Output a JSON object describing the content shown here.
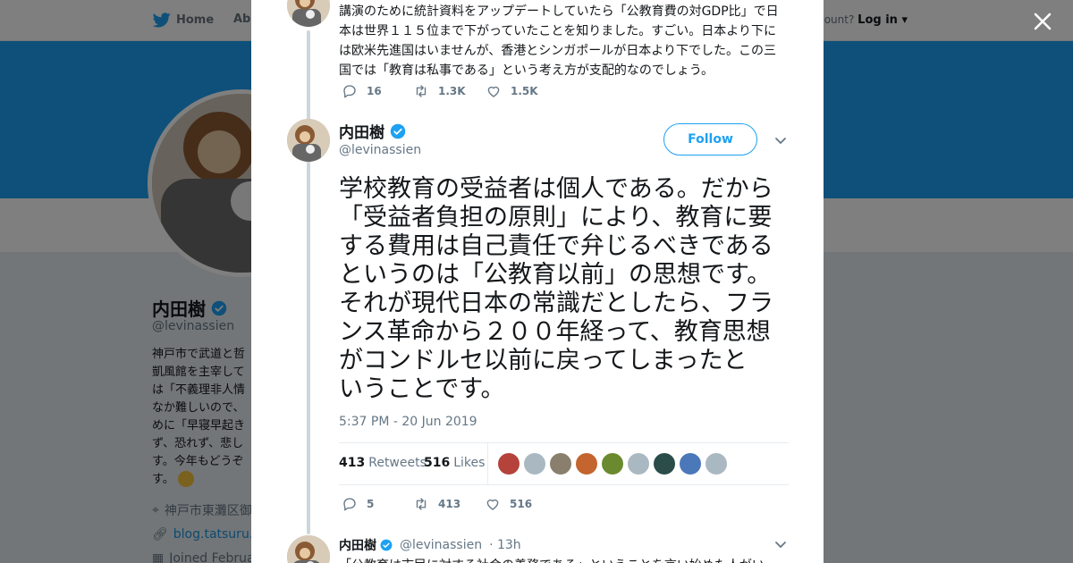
{
  "background": {
    "nav": {
      "home": "Home",
      "about": "Abo",
      "account_prompt": "ccount?",
      "login": "Log in"
    },
    "profile": {
      "name": "内田樹",
      "handle": "@levinassien",
      "bio": "神戸市で武道と哲\n凱風館を主宰して\nは「不義理非人情\nなか難しいので、\nめに「早寝早起き\nず、恐れず、悲し\nす。今年もどうぞ\nす。",
      "location": "神戸市東灘区御",
      "website": "blog.tatsuru.co",
      "joined": "Joined Februa"
    }
  },
  "modal": {
    "prev_tweet": {
      "text": "講演のために統計資料をアップデートしていたら「公教育費の対GDP比」で日\n本は世界１１５位まで下がっていたことを知りました。すごい。日本より下に\nは欧米先進国はいませんが、香港とシンガポールが日本より下でした。この三\n国では「教育は私事である」という考え方が支配的なのでしょう。",
      "replies": "16",
      "retweets": "1.3K",
      "likes": "1.5K"
    },
    "main_tweet": {
      "name": "内田樹",
      "handle": "@levinassien",
      "follow_label": "Follow",
      "text": "学校教育の受益者は個人である。だから\n「受益者負担の原則」により、教育に要\nする費用は自己責任で弁じるべきである\nというのは「公教育以前」の思想です。\nそれが現代日本の常識だとしたら、フラ\nンス革命から２００年経って、教育思想\nがコンドルセ以前に戻ってしまったと\nいうことです。",
      "timestamp": "5:37 PM - 20 Jun 2019",
      "retweet_count": "413",
      "retweet_label": "Retweets",
      "like_count": "516",
      "like_label": "Likes",
      "replies": "5",
      "retweets": "413",
      "likes": "516",
      "liker_colors": [
        "#b5423b",
        "#aab8c2",
        "#8a7f6c",
        "#c4642e",
        "#6b8a2f",
        "#aab8c2",
        "#2a4d4a",
        "#4a78b8",
        "#aab8c2"
      ]
    },
    "reply_tweet": {
      "name": "内田樹",
      "handle": "@levinassien",
      "time": "· 13h",
      "text": "「公教育は市民に対する社会の義務である」ということを言い始めた人がい"
    }
  },
  "colors": {
    "twitter_blue": "#1da1f2",
    "text": "#14171a",
    "muted": "#657786"
  }
}
